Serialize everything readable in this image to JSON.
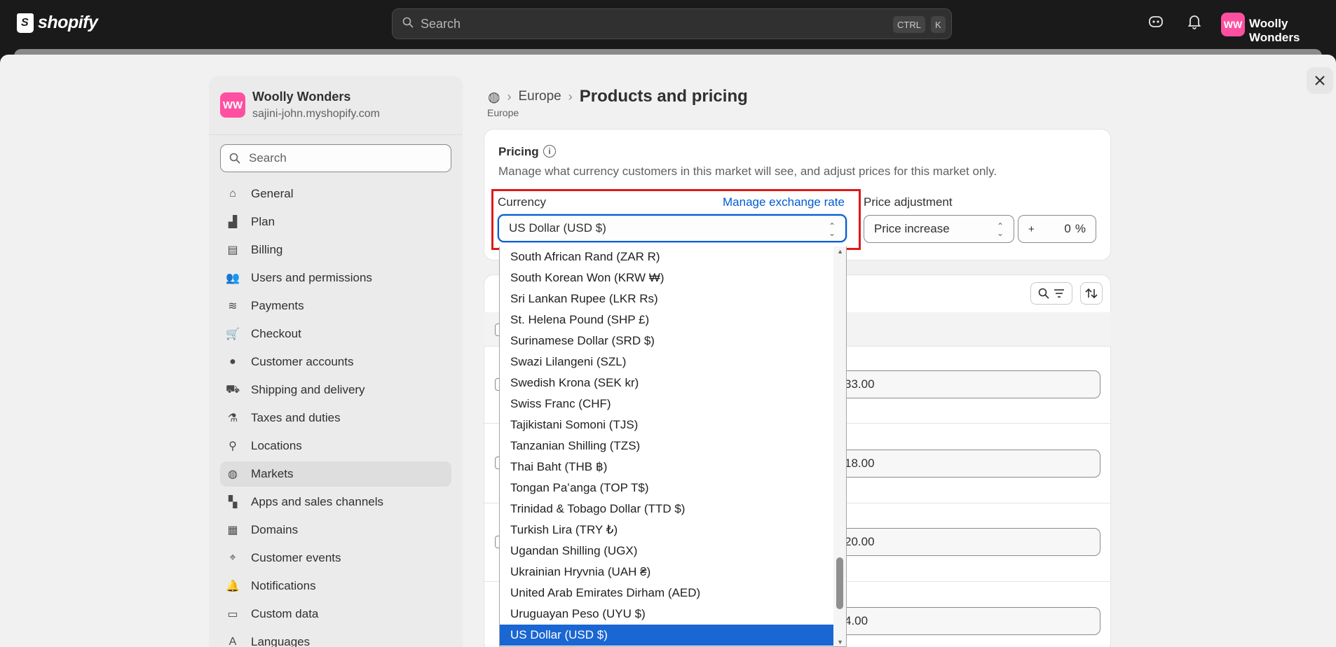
{
  "topbar": {
    "logo_text": "shopify",
    "search_placeholder": "Search",
    "shortcut_ctrl": "CTRL",
    "shortcut_key": "K",
    "avatar_initials": "WW",
    "store_name": "Woolly Wonders"
  },
  "sidebar": {
    "avatar_initials": "WW",
    "store_name": "Woolly Wonders",
    "store_domain": "sajini-john.myshopify.com",
    "search_placeholder": "Search",
    "items": [
      {
        "label": "General",
        "icon": "store-icon"
      },
      {
        "label": "Plan",
        "icon": "plan-icon"
      },
      {
        "label": "Billing",
        "icon": "billing-icon"
      },
      {
        "label": "Users and permissions",
        "icon": "users-icon"
      },
      {
        "label": "Payments",
        "icon": "payments-icon"
      },
      {
        "label": "Checkout",
        "icon": "cart-icon"
      },
      {
        "label": "Customer accounts",
        "icon": "person-icon"
      },
      {
        "label": "Shipping and delivery",
        "icon": "truck-icon"
      },
      {
        "label": "Taxes and duties",
        "icon": "tax-icon"
      },
      {
        "label": "Locations",
        "icon": "location-icon"
      },
      {
        "label": "Markets",
        "icon": "globe-icon",
        "active": true
      },
      {
        "label": "Apps and sales channels",
        "icon": "apps-icon"
      },
      {
        "label": "Domains",
        "icon": "domain-icon"
      },
      {
        "label": "Customer events",
        "icon": "cursor-icon"
      },
      {
        "label": "Notifications",
        "icon": "bell-icon"
      },
      {
        "label": "Custom data",
        "icon": "data-icon"
      },
      {
        "label": "Languages",
        "icon": "language-icon"
      }
    ]
  },
  "breadcrumb": {
    "parent": "Europe",
    "title": "Products and pricing",
    "subtitle": "Europe"
  },
  "pricing": {
    "title": "Pricing",
    "description": "Manage what currency customers in this market will see, and adjust prices for this market only.",
    "currency_label": "Currency",
    "manage_link": "Manage exchange rate",
    "currency_value": "US Dollar (USD $)",
    "adjustment_label": "Price adjustment",
    "adjustment_value": "Price increase",
    "percent_sign_prefix": "+",
    "percent_value": "0",
    "percent_suffix": "%"
  },
  "table": {
    "rows": [
      {
        "price": "33.00"
      },
      {
        "price": "18.00"
      },
      {
        "price": "20.00"
      },
      {
        "price": "4.00"
      }
    ]
  },
  "dropdown": {
    "options": [
      "South African Rand (ZAR R)",
      "South Korean Won (KRW ₩)",
      "Sri Lankan Rupee (LKR Rs)",
      "St. Helena Pound (SHP £)",
      "Surinamese Dollar (SRD $)",
      "Swazi Lilangeni (SZL)",
      "Swedish Krona (SEK kr)",
      "Swiss Franc (CHF)",
      "Tajikistani Somoni (TJS)",
      "Tanzanian Shilling (TZS)",
      "Thai Baht (THB ฿)",
      "Tongan Paʻanga (TOP T$)",
      "Trinidad & Tobago Dollar (TTD $)",
      "Turkish Lira (TRY ₺)",
      "Ugandan Shilling (UGX)",
      "Ukrainian Hryvnia (UAH ₴)",
      "United Arab Emirates Dirham (AED)",
      "Uruguayan Peso (UYU $)",
      "US Dollar (USD $)"
    ],
    "selected": "US Dollar (USD $)"
  },
  "colors": {
    "accent": "#005bd3",
    "selected_option": "#1a66d2",
    "highlight_box": "#e01818",
    "avatar": "#ff4fa0"
  }
}
